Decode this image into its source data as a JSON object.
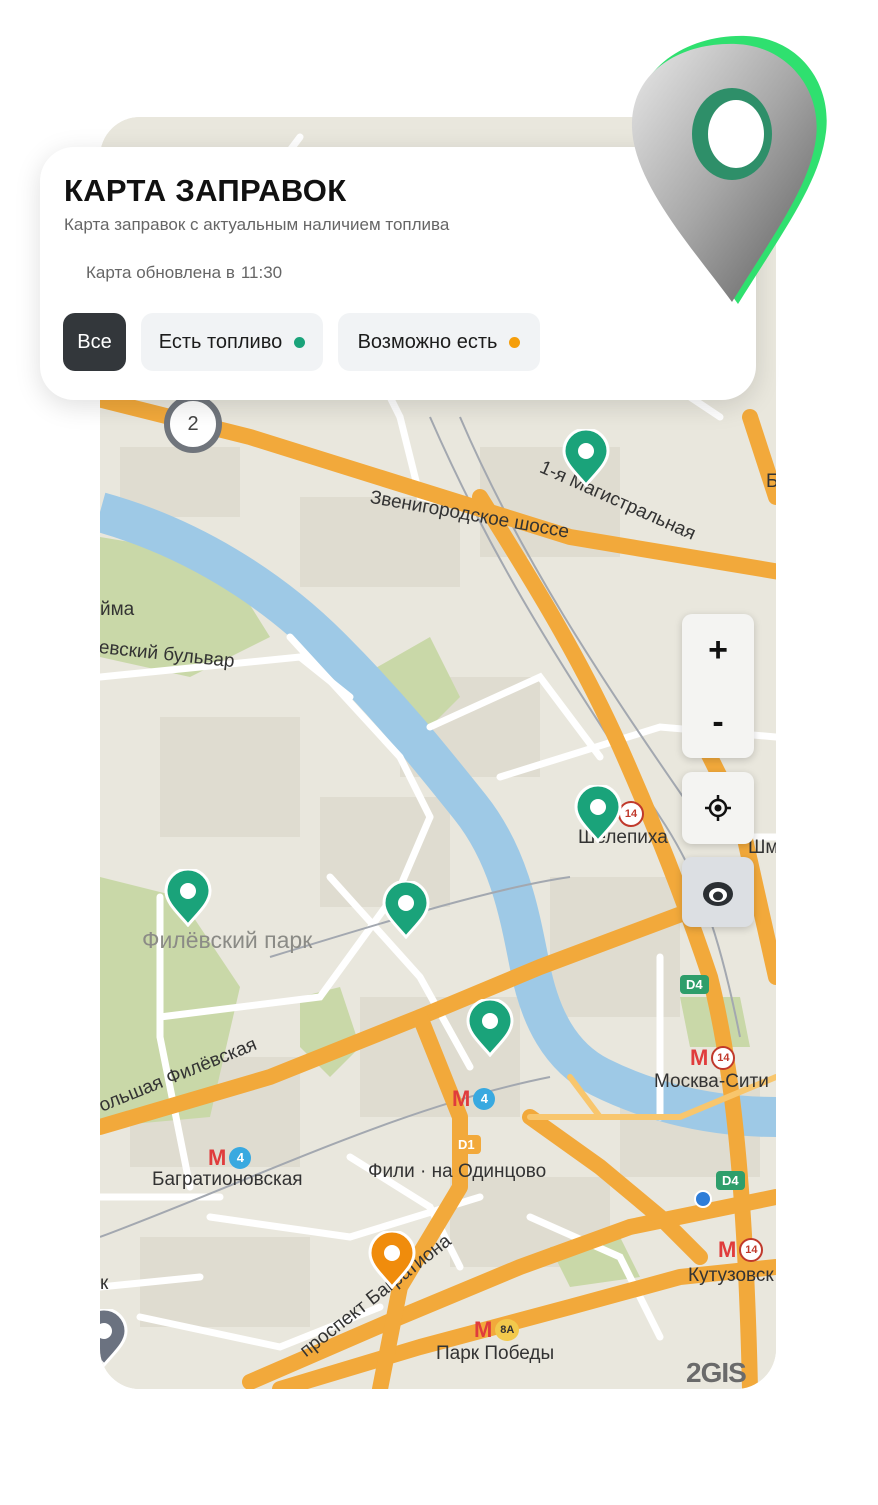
{
  "header": {
    "title": "КАРТА ЗАПРАВОК",
    "subtitle": "Карта заправок с актуальным наличием топлива",
    "updated_label": "Карта обновлена в",
    "updated_time": "11:30"
  },
  "filters": [
    {
      "label": "Все",
      "active": true
    },
    {
      "label": "Есть топливо",
      "dot_color": "#1aa37a"
    },
    {
      "label": "Возможно есть",
      "dot_color": "#f59e0b"
    }
  ],
  "map_controls": {
    "zoom_in": "+",
    "zoom_out": "-"
  },
  "cluster": {
    "count": "2"
  },
  "colors": {
    "fuel_available": "#1aa37a",
    "fuel_maybe": "#f08c0c",
    "unknown": "#6b7280"
  },
  "map_labels": {
    "zvenigorod": "Звенигородское шоссе",
    "magistral": "1-я Магистральная",
    "boulevard": "евский бульвар",
    "yima": "йма",
    "shelepikha": "Шелепиха",
    "park": "Филёвский парк",
    "bolshaya": "ольшая Филёвская",
    "bagration": "Багратионовская",
    "fili": "Фили · на Одинцово",
    "moscow_city": "Москва-Сити",
    "kutuzov": "Кутузовск",
    "prospect": "проспект Багратиона",
    "victory": "Парк Победы",
    "shm": "Шм",
    "b_edge": "Б",
    "k_edge": "к",
    "logo": "2GIS"
  },
  "metro_lines": {
    "l4": "4",
    "l14": "14",
    "l8a": "8A",
    "d1": "D1",
    "d4": "D4"
  }
}
